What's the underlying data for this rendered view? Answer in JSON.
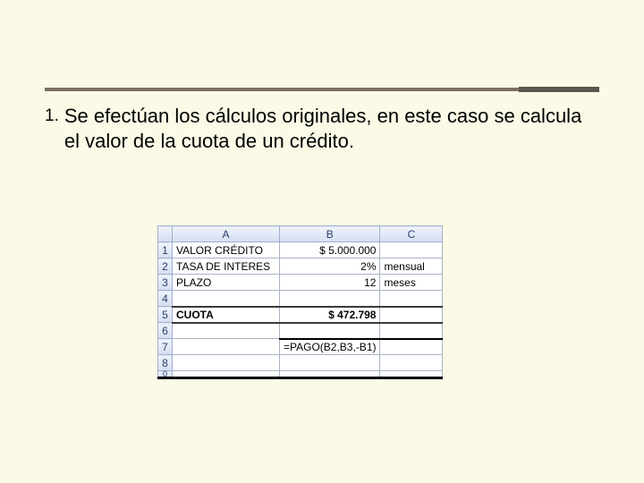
{
  "bullet": {
    "number": "1.",
    "text": "Se efectúan los cálculos originales, en este caso se calcula el valor de la cuota de un crédito."
  },
  "sheet": {
    "columns": [
      "A",
      "B",
      "C"
    ],
    "rows": {
      "r1": {
        "num": "1",
        "a": "VALOR CRÉDITO",
        "b": "$ 5.000.000",
        "c": ""
      },
      "r2": {
        "num": "2",
        "a": "TASA DE INTERES",
        "b": "2%",
        "c": "mensual"
      },
      "r3": {
        "num": "3",
        "a": "PLAZO",
        "b": "12",
        "c": "meses"
      },
      "r4": {
        "num": "4",
        "a": "",
        "b": "",
        "c": ""
      },
      "r5": {
        "num": "5",
        "a": "CUOTA",
        "b": "$ 472.798",
        "c": ""
      },
      "r6": {
        "num": "6",
        "a": "",
        "b": "",
        "c": ""
      },
      "r7": {
        "num": "7",
        "a": "",
        "b": "=PAGO(B2,B3,-B1)",
        "c": ""
      },
      "r8": {
        "num": "8",
        "a": "",
        "b": "",
        "c": ""
      },
      "r9": {
        "num": "0",
        "a": "",
        "b": "",
        "c": ""
      }
    }
  }
}
